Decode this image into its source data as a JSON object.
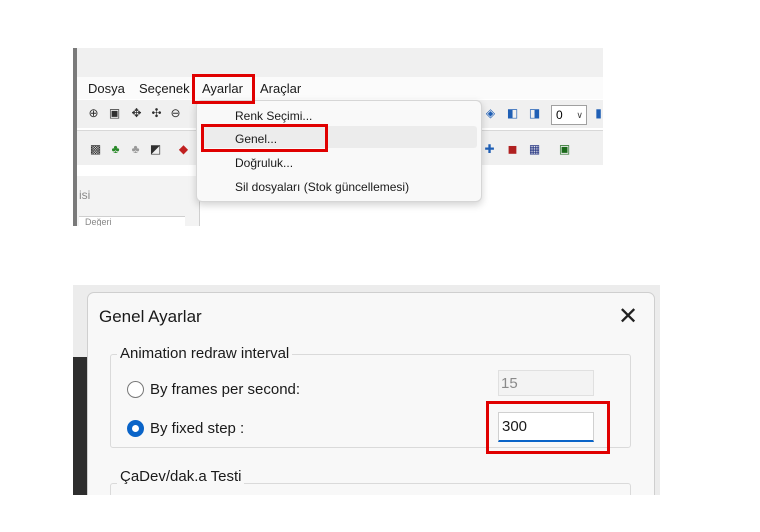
{
  "menu_screenshot": {
    "menubar": [
      "Dosya",
      "Seçenek",
      "Ayarlar",
      "Araçlar"
    ],
    "dropdown_items": [
      "Renk Seçimi...",
      "Genel...",
      "Doğruluk...",
      "Sil dosyaları (Stok güncellemesi)"
    ],
    "highlighted_item": "Genel...",
    "toolbar_value": "0",
    "side_panel_label": "isi",
    "side_panel_sublabel": "Değeri",
    "highlight_color": "#e00000"
  },
  "dialog": {
    "title": "Genel Ayarlar",
    "close_icon": "✕",
    "animation_group_label": "Animation redraw interval",
    "fps_label": "By frames per second:",
    "fps_value": "15",
    "fixed_step_label": "By fixed step :",
    "fixed_step_value": "300",
    "fixed_step_selected": true,
    "next_group_label": "ÇaDev/dak.a Testi",
    "accent_color": "#0a64c8"
  }
}
